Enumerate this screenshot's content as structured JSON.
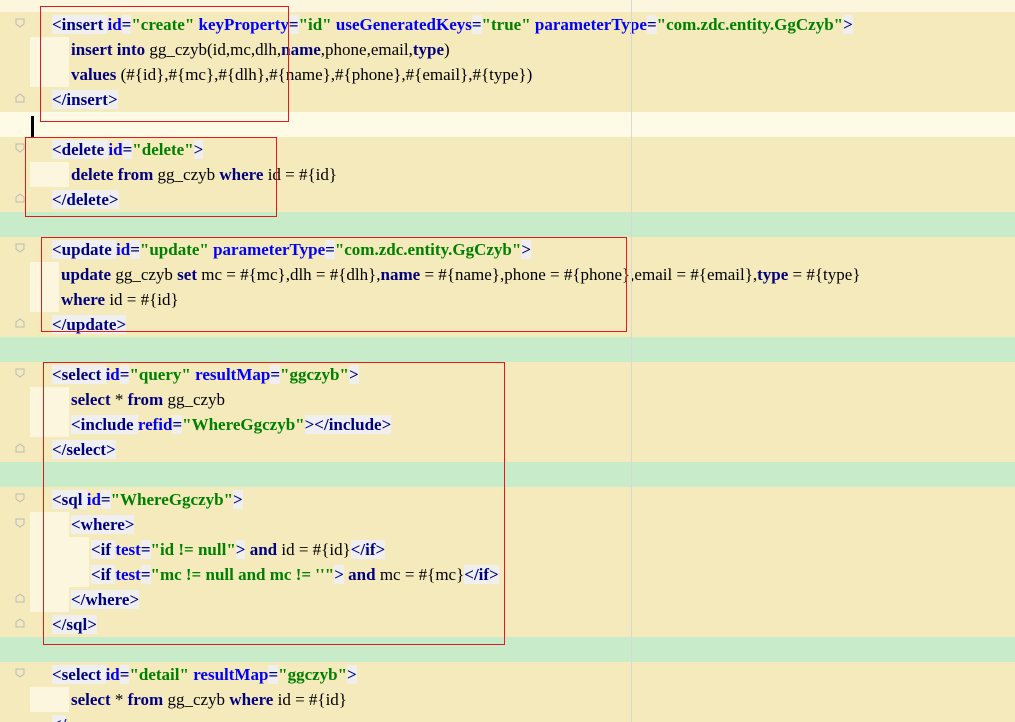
{
  "editor": {
    "language": "xml",
    "lines": [
      [
        [
          "tok-tag",
          "<insert "
        ],
        [
          "tok-attr",
          "id"
        ],
        [
          "tok-tag",
          "="
        ],
        [
          "tok-val",
          "\"create\""
        ],
        [
          "tok-txt",
          " "
        ],
        [
          "tok-attr",
          "keyProperty"
        ],
        [
          "tok-tag",
          "="
        ],
        [
          "tok-val",
          "\"id\""
        ],
        [
          "tok-txt",
          " "
        ],
        [
          "tok-attr",
          "useGeneratedKeys"
        ],
        [
          "tok-tag",
          "="
        ],
        [
          "tok-val",
          "\"true\""
        ],
        [
          "tok-txt",
          " "
        ],
        [
          "tok-attr",
          "parameterType"
        ],
        [
          "tok-tag",
          "="
        ],
        [
          "tok-val",
          "\"com.zdc.entity.GgCzyb\""
        ],
        [
          "tok-tag",
          ">"
        ]
      ],
      [
        [
          "tok-kw",
          "insert into"
        ],
        [
          "tok-txt",
          " gg_czyb(id,mc,dlh,"
        ],
        [
          "tok-kw",
          "name"
        ],
        [
          "tok-txt",
          ",phone,email,"
        ],
        [
          "tok-kw",
          "type"
        ],
        [
          "tok-txt",
          ")"
        ]
      ],
      [
        [
          "tok-kw",
          "values"
        ],
        [
          "tok-txt",
          " (#{id},#{mc},#{dlh},#{name},#{phone},#{email},#{type})"
        ]
      ],
      [
        [
          "tok-tag",
          "</insert>"
        ]
      ],
      [],
      [
        [
          "tok-tag",
          "<delete "
        ],
        [
          "tok-attr",
          "id"
        ],
        [
          "tok-tag",
          "="
        ],
        [
          "tok-val",
          "\"delete\""
        ],
        [
          "tok-tag",
          ">"
        ]
      ],
      [
        [
          "tok-kw",
          "delete from"
        ],
        [
          "tok-txt",
          " gg_czyb "
        ],
        [
          "tok-kw",
          "where"
        ],
        [
          "tok-txt",
          " id = #{id}"
        ]
      ],
      [
        [
          "tok-tag",
          "</delete>"
        ]
      ],
      [],
      [
        [
          "tok-tag",
          "<update "
        ],
        [
          "tok-attr",
          "id"
        ],
        [
          "tok-tag",
          "="
        ],
        [
          "tok-val",
          "\"update\""
        ],
        [
          "tok-txt",
          " "
        ],
        [
          "tok-attr",
          "parameterType"
        ],
        [
          "tok-tag",
          "="
        ],
        [
          "tok-val",
          "\"com.zdc.entity.GgCzyb\""
        ],
        [
          "tok-tag",
          ">"
        ]
      ],
      [
        [
          "tok-kw",
          "update"
        ],
        [
          "tok-txt",
          " gg_czyb "
        ],
        [
          "tok-kw",
          "set"
        ],
        [
          "tok-txt",
          " mc = #{mc},dlh = #{dlh},"
        ],
        [
          "tok-kw",
          "name"
        ],
        [
          "tok-txt",
          " = #{name},phone = #{phone},email = #{email},"
        ],
        [
          "tok-kw",
          "type"
        ],
        [
          "tok-txt",
          " = #{type}"
        ]
      ],
      [
        [
          "tok-kw",
          "where"
        ],
        [
          "tok-txt",
          " id = #{id}"
        ]
      ],
      [
        [
          "tok-tag",
          "</update>"
        ]
      ],
      [],
      [
        [
          "tok-tag",
          "<select "
        ],
        [
          "tok-attr",
          "id"
        ],
        [
          "tok-tag",
          "="
        ],
        [
          "tok-val",
          "\"query\""
        ],
        [
          "tok-txt",
          " "
        ],
        [
          "tok-attr",
          "resultMap"
        ],
        [
          "tok-tag",
          "="
        ],
        [
          "tok-val",
          "\"ggczyb\""
        ],
        [
          "tok-tag",
          ">"
        ]
      ],
      [
        [
          "tok-kw",
          "select"
        ],
        [
          "tok-txt",
          " * "
        ],
        [
          "tok-kw",
          "from"
        ],
        [
          "tok-txt",
          " gg_czyb"
        ]
      ],
      [
        [
          "tok-tag",
          "<include "
        ],
        [
          "tok-attr",
          "refid"
        ],
        [
          "tok-tag",
          "="
        ],
        [
          "tok-val",
          "\"WhereGgczyb\""
        ],
        [
          "tok-tag",
          "></include>"
        ]
      ],
      [
        [
          "tok-tag",
          "</select>"
        ]
      ],
      [],
      [
        [
          "tok-tag",
          "<sql "
        ],
        [
          "tok-attr",
          "id"
        ],
        [
          "tok-tag",
          "="
        ],
        [
          "tok-val",
          "\"WhereGgczyb\""
        ],
        [
          "tok-tag",
          ">"
        ]
      ],
      [
        [
          "tok-tag",
          "<where>"
        ]
      ],
      [
        [
          "tok-tag",
          "<if "
        ],
        [
          "tok-attr",
          "test"
        ],
        [
          "tok-tag",
          "="
        ],
        [
          "tok-val",
          "\"id != null\""
        ],
        [
          "tok-tag",
          ">"
        ],
        [
          "tok-txt",
          " "
        ],
        [
          "tok-kw",
          "and"
        ],
        [
          "tok-txt",
          " id = #{id}"
        ],
        [
          "tok-tag",
          "</if>"
        ]
      ],
      [
        [
          "tok-tag",
          "<if "
        ],
        [
          "tok-attr",
          "test"
        ],
        [
          "tok-tag",
          "="
        ],
        [
          "tok-val",
          "\"mc != null and mc != ''\""
        ],
        [
          "tok-tag",
          ">"
        ],
        [
          "tok-txt",
          " "
        ],
        [
          "tok-kw",
          "and"
        ],
        [
          "tok-txt",
          " mc = #{mc}"
        ],
        [
          "tok-tag",
          "</if>"
        ]
      ],
      [
        [
          "tok-tag",
          "</where>"
        ]
      ],
      [
        [
          "tok-tag",
          "</sql>"
        ]
      ],
      [],
      [
        [
          "tok-tag",
          "<select "
        ],
        [
          "tok-attr",
          "id"
        ],
        [
          "tok-tag",
          "="
        ],
        [
          "tok-val",
          "\"detail\""
        ],
        [
          "tok-txt",
          " "
        ],
        [
          "tok-attr",
          "resultMap"
        ],
        [
          "tok-tag",
          "="
        ],
        [
          "tok-val",
          "\"ggczyb\""
        ],
        [
          "tok-tag",
          ">"
        ]
      ],
      [
        [
          "tok-kw",
          "select"
        ],
        [
          "tok-txt",
          " * "
        ],
        [
          "tok-kw",
          "from"
        ],
        [
          "tok-txt",
          " gg_czyb "
        ],
        [
          "tok-kw",
          "where"
        ],
        [
          "tok-txt",
          " id = #{id}"
        ]
      ],
      [
        [
          "tok-tag",
          "</"
        ]
      ]
    ],
    "current_line": 5
  },
  "annotation_color": "#e01b1b",
  "gutter_icons": [
    "fold-start-icon",
    "fold-end-icon"
  ],
  "highlight_colors": {
    "code": "#f5eabb",
    "injected": "#c8ebc9",
    "current_line": "#fdfbe6"
  }
}
